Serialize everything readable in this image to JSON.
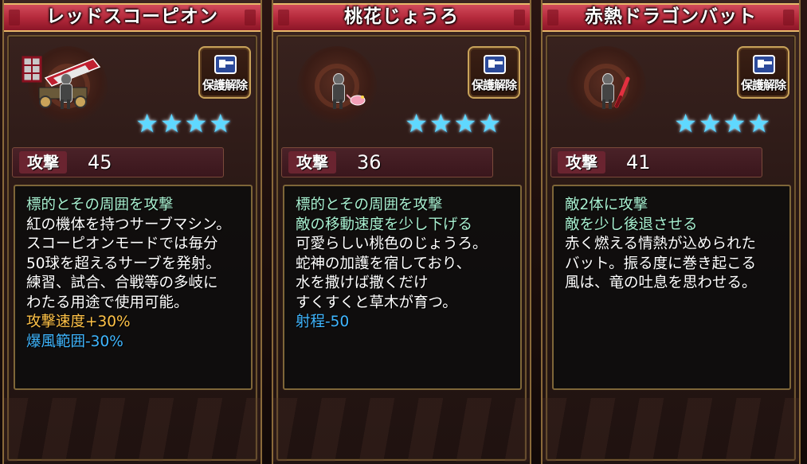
{
  "cards": [
    {
      "name": "レッドスコーピオン",
      "lock_label": "保護解除",
      "stars": [
        "★",
        "★",
        "★",
        "★"
      ],
      "stat_label": "攻撃",
      "stat_value": "45",
      "lines": [
        {
          "text": "標的とその周囲を攻撃",
          "style": "green"
        },
        {
          "text": "紅の機体を持つサーブマシン。",
          "style": "white"
        },
        {
          "text": "スコーピオンモードでは毎分",
          "style": "white"
        },
        {
          "text": "50球を超えるサーブを発射。",
          "style": "white"
        },
        {
          "text": "練習、試合、合戦等の多岐に",
          "style": "white"
        },
        {
          "text": "わたる用途で使用可能。",
          "style": "white"
        },
        {
          "text": "攻撃速度+30%",
          "style": "gold"
        },
        {
          "text": "爆風範囲-30%",
          "style": "blue"
        }
      ]
    },
    {
      "name": "桃花じょうろ",
      "lock_label": "保護解除",
      "stars": [
        "★",
        "★",
        "★",
        "★"
      ],
      "stat_label": "攻撃",
      "stat_value": "36",
      "lines": [
        {
          "text": "標的とその周囲を攻撃",
          "style": "green"
        },
        {
          "text": "敵の移動速度を少し下げる",
          "style": "green"
        },
        {
          "text": "可愛らしい桃色のじょうろ。",
          "style": "white"
        },
        {
          "text": "蛇神の加護を宿しており、",
          "style": "white"
        },
        {
          "text": "水を撒けば撒くだけ",
          "style": "white"
        },
        {
          "text": "すくすくと草木が育つ。",
          "style": "white"
        },
        {
          "text": "射程-50",
          "style": "blue"
        }
      ]
    },
    {
      "name": "赤熱ドラゴンバット",
      "lock_label": "保護解除",
      "stars": [
        "★",
        "★",
        "★",
        "★"
      ],
      "stat_label": "攻撃",
      "stat_value": "41",
      "lines": [
        {
          "text": "敵2体に攻撃",
          "style": "green"
        },
        {
          "text": "敵を少し後退させる",
          "style": "green"
        },
        {
          "text": "赤く燃える情熱が込められた",
          "style": "white"
        },
        {
          "text": "バット。振る度に巻き起こる",
          "style": "white"
        },
        {
          "text": "風は、竜の吐息を思わせる。",
          "style": "white"
        }
      ]
    }
  ],
  "icons": {
    "lock": "unlock-key-icon",
    "star": "star-icon",
    "weapon_1": "serve-machine-icon",
    "weapon_2": "watering-can-icon",
    "weapon_3": "bat-icon",
    "character": "ninja-figure-icon"
  },
  "colors": {
    "banner": "#b52a3c",
    "star": "#5fd8ff",
    "effect_text": "#a8f0d0",
    "buff_text": "#ffc247",
    "debuff_text": "#3fb6ff"
  }
}
